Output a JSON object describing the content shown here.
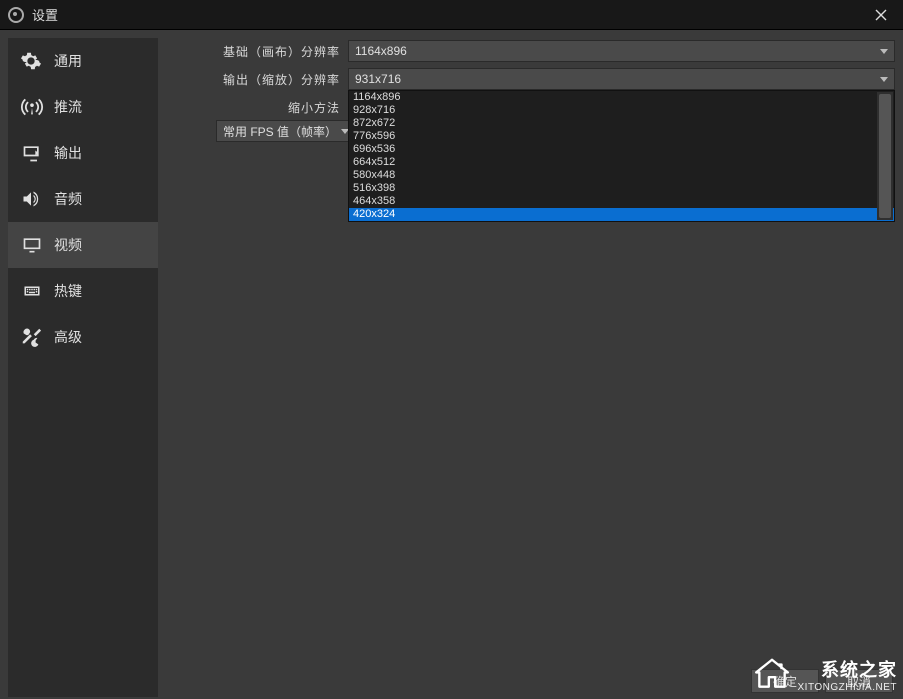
{
  "title": "设置",
  "sidebar": {
    "items": [
      {
        "label": "通用"
      },
      {
        "label": "推流"
      },
      {
        "label": "输出"
      },
      {
        "label": "音频"
      },
      {
        "label": "视频"
      },
      {
        "label": "热键"
      },
      {
        "label": "高级"
      }
    ]
  },
  "form": {
    "base_res_label": "基础（画布）分辨率",
    "base_res_value": "1164x896",
    "output_res_label": "输出（缩放）分辨率",
    "output_res_value": "931x716",
    "scale_method_label": "缩小方法",
    "fps_label": "常用 FPS 值（帧率）"
  },
  "dropdown_options": [
    "1164x896",
    "928x716",
    "872x672",
    "776x596",
    "696x536",
    "664x512",
    "580x448",
    "516x398",
    "464x358",
    "420x324"
  ],
  "dropdown_highlighted_index": 9,
  "buttons": {
    "ok": "确定",
    "cancel": "取消"
  },
  "watermark": {
    "line1": "系统之家",
    "line2": "XITONGZHIJIA.NET"
  }
}
